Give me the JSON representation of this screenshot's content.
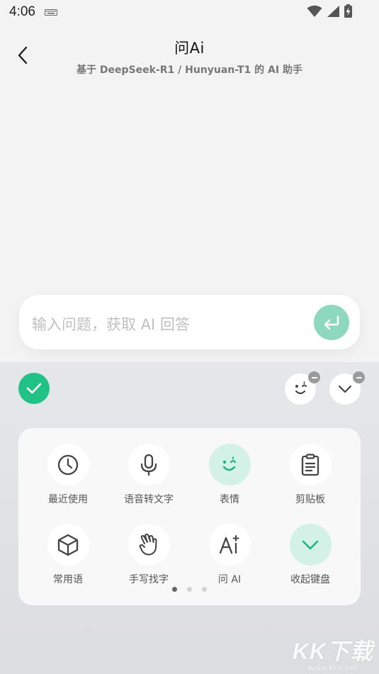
{
  "status_bar": {
    "time": "4:06"
  },
  "header": {
    "title": "问Ai",
    "subtitle": "基于 DeepSeek-R1 / Hunyuan-T1 的 AI 助手"
  },
  "input": {
    "placeholder": "输入问题，获取 AI 回答"
  },
  "tools": [
    {
      "label": "最近使用",
      "icon": "clock-icon"
    },
    {
      "label": "语音转文字",
      "icon": "microphone-icon"
    },
    {
      "label": "表情",
      "icon": "emoji-face-icon",
      "active": true
    },
    {
      "label": "剪贴板",
      "icon": "clipboard-icon"
    },
    {
      "label": "常用语",
      "icon": "cube-icon"
    },
    {
      "label": "手写找字",
      "icon": "handwriting-hand-icon"
    },
    {
      "label": "问 AI",
      "icon": "ai-sparkle-icon"
    },
    {
      "label": "收起键盘",
      "icon": "chevron-down-icon",
      "active": true
    }
  ],
  "pagination": {
    "pages": 3,
    "current": 1
  },
  "watermark": {
    "logo": "KK下载",
    "url": "www.kkx.net"
  },
  "colors": {
    "accent": "#22c185",
    "accent_light": "#d3f1e6",
    "send_button": "#8fd8c0"
  }
}
